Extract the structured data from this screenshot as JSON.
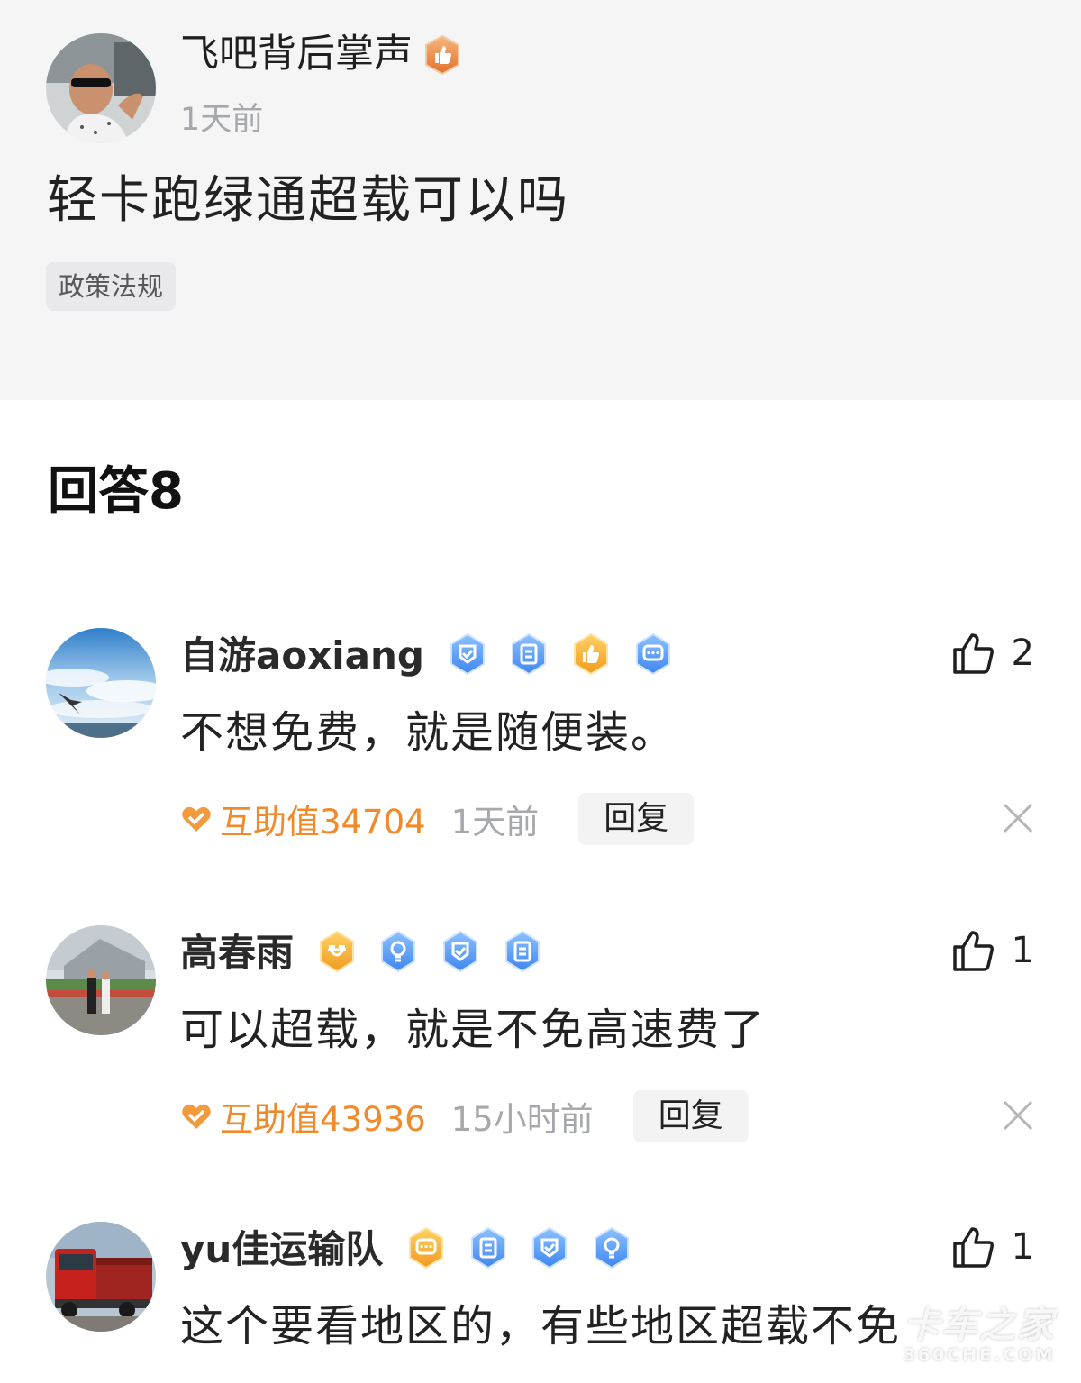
{
  "question": {
    "author": "飞吧背后掌声",
    "author_badge": "thumbs-up-badge-orange",
    "time": "1天前",
    "title": "轻卡跑绿通超载可以吗",
    "tag": "政策法规"
  },
  "answers_header": "回答8",
  "answers": [
    {
      "name": "自游aoxiang",
      "badges": [
        "shield-check-badge-blue",
        "document-badge-blue",
        "thumbs-up-badge-gold",
        "chat-badge-blue"
      ],
      "likes": "2",
      "content": "不想免费，就是随便装。",
      "help_value": "互助值34704",
      "time": "1天前",
      "reply_label": "回复"
    },
    {
      "name": "高春雨",
      "badges": [
        "smile-badge-gold",
        "bulb-badge-blue",
        "shield-check-badge-blue",
        "document-badge-blue"
      ],
      "likes": "1",
      "content": "可以超载，就是不免高速费了",
      "help_value": "互助值43936",
      "time": "15小时前",
      "reply_label": "回复"
    },
    {
      "name": "yu佳运输队",
      "badges": [
        "chat-badge-gold",
        "document-badge-blue",
        "shield-check-badge-blue",
        "bulb-badge-blue"
      ],
      "likes": "1",
      "content": "这个要看地区的，有些地区超载不免"
    }
  ],
  "watermark": {
    "line1": "卡车之家",
    "line2": "360CHE.COM"
  },
  "colors": {
    "question_bg": "#f5f5f6",
    "help_orange": "#f08a2a",
    "badge_blue": "#5b9cf5",
    "badge_gold": "#f2a52e",
    "muted_gray": "#a6a8ad"
  }
}
